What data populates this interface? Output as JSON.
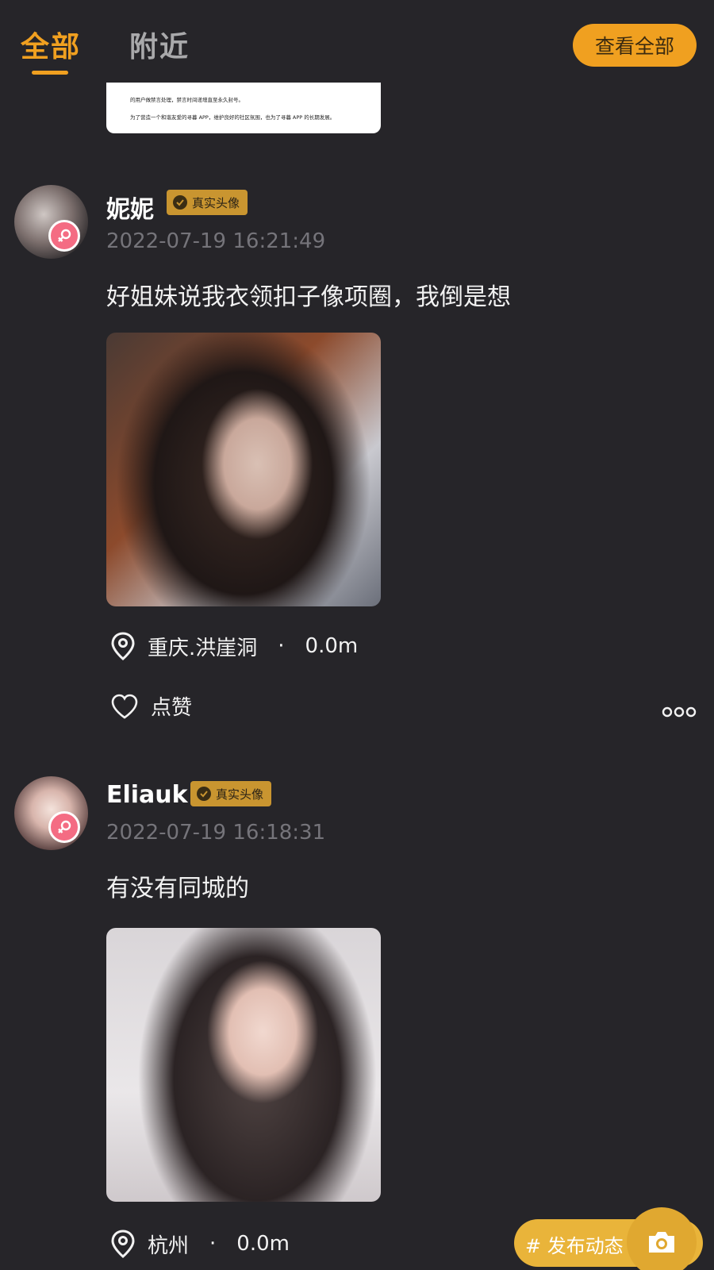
{
  "header": {
    "tabs": [
      {
        "label": "全部",
        "active": true
      },
      {
        "label": "附近",
        "active": false
      }
    ],
    "view_all_label": "查看全部"
  },
  "notice_image": {
    "line1": "的用户做禁言处理，禁言时间递增直至永久封号。",
    "line2": "为了营造一个和谐友爱的寻暮 APP，维护良好的社区氛围，也为了寻暮 APP 的长期发展。"
  },
  "posts": [
    {
      "username": "妮妮",
      "verified_label": "真实头像",
      "timestamp": "2022-07-19 16:21:49",
      "text": "好姐妹说我衣领扣子像项圈，我倒是想",
      "location": "重庆.洪崖洞",
      "separator": "·",
      "distance": "0.0m",
      "like_label": "点赞"
    },
    {
      "username": "Eliauk",
      "verified_label": "真实头像",
      "timestamp": "2022-07-19 16:18:31",
      "text": "有没有同城的",
      "location": "杭州",
      "separator": "·",
      "distance": "0.0m"
    }
  ],
  "fab": {
    "publish_label": "# 发布动态"
  },
  "colors": {
    "background": "#262529",
    "accent": "#f0a020",
    "badge": "#c99530",
    "female": "#f46c83",
    "muted_text": "#75747a"
  },
  "icons": [
    "location-pin-icon",
    "heart-icon",
    "more-dots-icon",
    "camera-icon",
    "female-icon",
    "verified-check-icon"
  ]
}
